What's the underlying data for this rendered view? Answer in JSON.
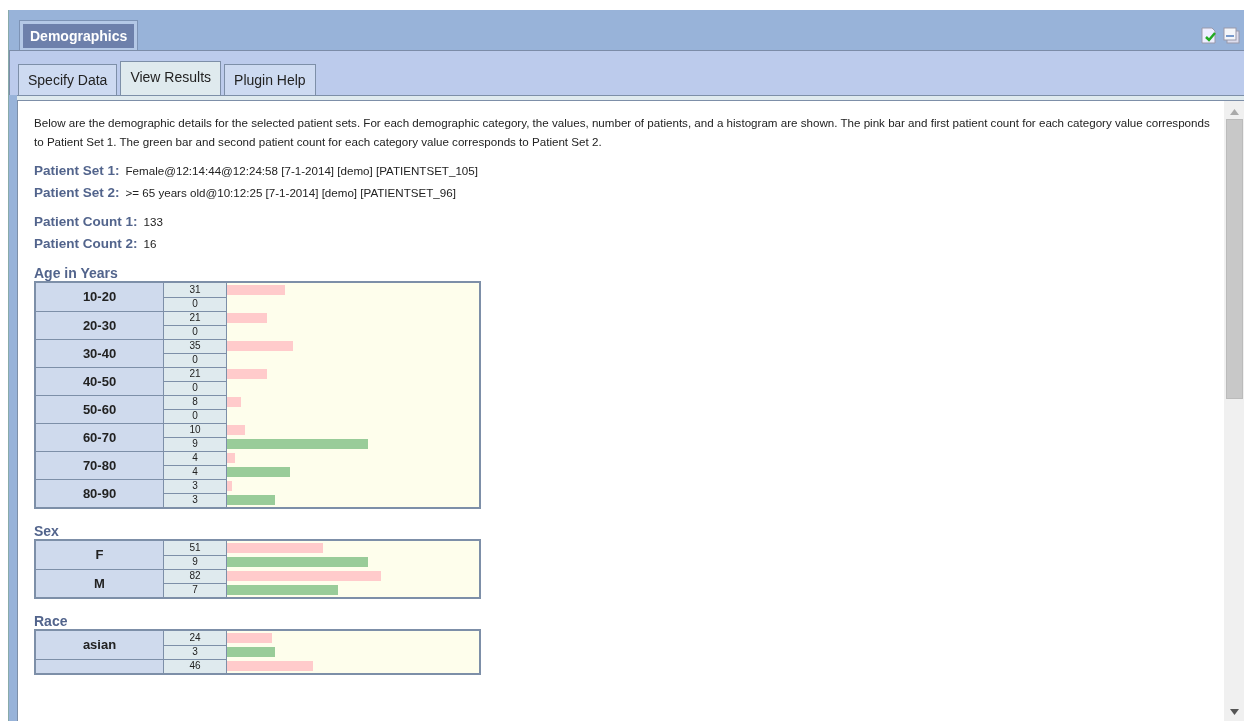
{
  "panel": {
    "title": "Demographics"
  },
  "tabs": [
    {
      "label": "Specify Data",
      "selected": false
    },
    {
      "label": "View Results",
      "selected": true
    },
    {
      "label": "Plugin Help",
      "selected": false
    }
  ],
  "intro": "Below are the demographic details for the selected patient sets. For each demographic category, the values, number of patients, and a histogram are shown. The pink bar and first patient count for each category value corresponds to Patient Set 1. The green bar and second patient count for each category value corresponds to Patient Set 2.",
  "patient_sets": [
    {
      "label": "Patient Set 1:",
      "value": "Female@12:14:44@12:24:58 [7-1-2014] [demo] [PATIENTSET_105]"
    },
    {
      "label": "Patient Set 2:",
      "value": ">= 65 years old@10:12:25 [7-1-2014] [demo] [PATIENTSET_96]"
    }
  ],
  "patient_counts": [
    {
      "label": "Patient Count 1:",
      "value": "133"
    },
    {
      "label": "Patient Count 2:",
      "value": "16"
    }
  ],
  "categories": [
    {
      "title": "Age in Years",
      "rows": [
        {
          "value": "10-20",
          "bars": [
            {
              "count": "31",
              "level": 0.23
            },
            {
              "count": "0"
            }
          ]
        },
        {
          "value": "20-30",
          "bars": [
            {
              "count": "21",
              "level": 0.16
            },
            {
              "count": "0"
            }
          ]
        },
        {
          "value": "30-40",
          "bars": [
            {
              "count": "35",
              "level": 0.26
            },
            {
              "count": "0"
            }
          ]
        },
        {
          "value": "40-50",
          "bars": [
            {
              "count": "21",
              "level": 0.16
            },
            {
              "count": "0"
            }
          ]
        },
        {
          "value": "50-60",
          "bars": [
            {
              "count": "8",
              "level": 0.055
            },
            {
              "count": "0"
            }
          ]
        },
        {
          "value": "60-70",
          "bars": [
            {
              "count": "10",
              "level": 0.07
            },
            {
              "count": "9",
              "level": 0.56
            }
          ]
        },
        {
          "value": "70-80",
          "bars": [
            {
              "count": "4",
              "level": 0.03
            },
            {
              "count": "4",
              "level": 0.25
            }
          ]
        },
        {
          "value": "80-90",
          "bars": [
            {
              "count": "3",
              "level": 0.02
            },
            {
              "count": "3",
              "level": 0.19
            }
          ]
        }
      ]
    },
    {
      "title": "Sex",
      "rows": [
        {
          "value": "F",
          "bars": [
            {
              "count": "51",
              "level": 0.38
            },
            {
              "count": "9",
              "level": 0.56
            }
          ]
        },
        {
          "value": "M",
          "bars": [
            {
              "count": "82",
              "level": 0.61
            },
            {
              "count": "7",
              "level": 0.44
            }
          ]
        }
      ]
    },
    {
      "title": "Race",
      "rows": [
        {
          "value": "asian",
          "bars": [
            {
              "count": "24",
              "level": 0.18
            },
            {
              "count": "3",
              "level": 0.19
            }
          ]
        },
        {
          "bars": [
            {
              "count": "46",
              "level": 0.34
            }
          ]
        }
      ]
    }
  ]
}
